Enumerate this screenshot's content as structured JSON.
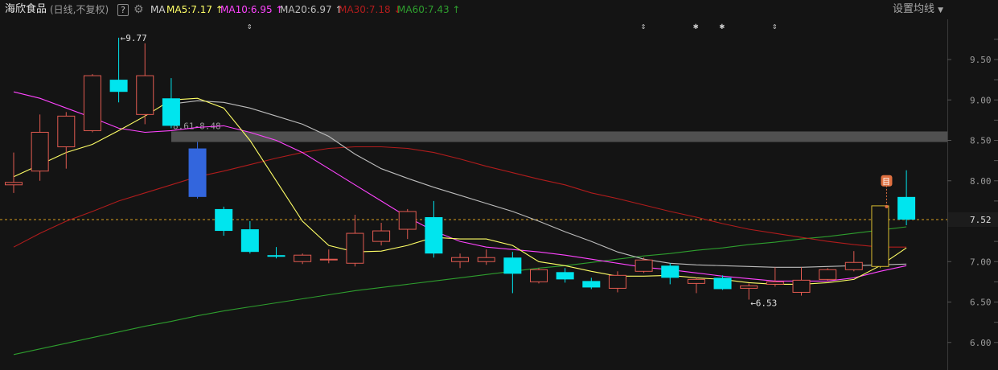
{
  "header": {
    "stock_name": "海欣食品",
    "mode": "(日线,不复权)",
    "help": "?",
    "settings_label": "设置均线",
    "indicator_label": "MA",
    "ma": [
      {
        "label": "MA5:7.17",
        "arrow": "↑",
        "color": "#ffff66"
      },
      {
        "label": "MA10:6.95",
        "arrow": "↑",
        "color": "#ff44ff"
      },
      {
        "label": "MA20:6.97",
        "arrow": "↑",
        "color": "#bdbdbd"
      },
      {
        "label": "MA30:7.18",
        "arrow": "↓",
        "color": "#b01c1c"
      },
      {
        "label": "MA60:7.43",
        "arrow": "↑",
        "color": "#2e9e2e"
      }
    ]
  },
  "chart_data": {
    "type": "candlestick",
    "y_ticks": [
      "9.50",
      "9.00",
      "8.50",
      "8.00",
      "7.50",
      "7.00",
      "6.50",
      "6.00"
    ],
    "ylim": [
      5.95,
      9.95
    ],
    "current_price": "7.52",
    "high_label": "9.77",
    "low_label": "6.53",
    "gap_label": "8.61-8.48",
    "gap_range": [
      8.48,
      8.61
    ],
    "marker_badge": "目",
    "colors": {
      "up": "#e05a50",
      "down": "#00e5ee",
      "big_down": "#3366dd",
      "doji": "#d4b830",
      "ma5": "#ffff66",
      "ma10": "#ff44ff",
      "ma20": "#bdbdbd",
      "ma30": "#b01c1c",
      "ma60": "#2e9e2e"
    },
    "candles": [
      {
        "o": 7.95,
        "h": 8.35,
        "l": 7.85,
        "c": 7.98
      },
      {
        "o": 8.12,
        "h": 8.82,
        "l": 8.0,
        "c": 8.6
      },
      {
        "o": 8.42,
        "h": 8.85,
        "l": 8.15,
        "c": 8.8
      },
      {
        "o": 8.62,
        "h": 9.32,
        "l": 8.6,
        "c": 9.3
      },
      {
        "o": 9.25,
        "h": 9.77,
        "l": 8.97,
        "c": 9.1
      },
      {
        "o": 8.82,
        "h": 9.7,
        "l": 8.7,
        "c": 9.3
      },
      {
        "o": 9.02,
        "h": 9.27,
        "l": 8.65,
        "c": 8.68
      },
      {
        "o": 8.4,
        "h": 8.48,
        "l": 7.78,
        "c": 7.8,
        "big": true
      },
      {
        "o": 7.65,
        "h": 7.68,
        "l": 7.32,
        "c": 7.38
      },
      {
        "o": 7.4,
        "h": 7.5,
        "l": 7.1,
        "c": 7.12
      },
      {
        "o": 7.08,
        "h": 7.18,
        "l": 7.04,
        "c": 7.06
      },
      {
        "o": 7.0,
        "h": 7.1,
        "l": 6.97,
        "c": 7.08
      },
      {
        "o": 7.02,
        "h": 7.15,
        "l": 6.98,
        "c": 7.03
      },
      {
        "o": 6.98,
        "h": 7.58,
        "l": 6.94,
        "c": 7.35
      },
      {
        "o": 7.25,
        "h": 7.48,
        "l": 7.2,
        "c": 7.38
      },
      {
        "o": 7.4,
        "h": 7.65,
        "l": 7.28,
        "c": 7.62
      },
      {
        "o": 7.55,
        "h": 7.75,
        "l": 7.05,
        "c": 7.1
      },
      {
        "o": 7.0,
        "h": 7.1,
        "l": 6.92,
        "c": 7.05
      },
      {
        "o": 7.0,
        "h": 7.15,
        "l": 6.96,
        "c": 7.05
      },
      {
        "o": 7.05,
        "h": 7.12,
        "l": 6.61,
        "c": 6.85
      },
      {
        "o": 6.75,
        "h": 6.92,
        "l": 6.73,
        "c": 6.9
      },
      {
        "o": 6.87,
        "h": 6.92,
        "l": 6.74,
        "c": 6.78
      },
      {
        "o": 6.76,
        "h": 6.8,
        "l": 6.66,
        "c": 6.68
      },
      {
        "o": 6.67,
        "h": 6.88,
        "l": 6.62,
        "c": 6.83
      },
      {
        "o": 6.88,
        "h": 7.05,
        "l": 6.86,
        "c": 7.02
      },
      {
        "o": 6.95,
        "h": 6.98,
        "l": 6.72,
        "c": 6.8
      },
      {
        "o": 6.73,
        "h": 6.8,
        "l": 6.61,
        "c": 6.78
      },
      {
        "o": 6.8,
        "h": 6.83,
        "l": 6.65,
        "c": 6.66
      },
      {
        "o": 6.67,
        "h": 6.73,
        "l": 6.53,
        "c": 6.7
      },
      {
        "o": 6.72,
        "h": 6.93,
        "l": 6.69,
        "c": 6.75
      },
      {
        "o": 6.62,
        "h": 6.93,
        "l": 6.58,
        "c": 6.77
      },
      {
        "o": 6.78,
        "h": 6.92,
        "l": 6.76,
        "c": 6.9
      },
      {
        "o": 6.9,
        "h": 7.13,
        "l": 6.88,
        "c": 6.99
      },
      {
        "o": 6.94,
        "h": 7.69,
        "l": 6.92,
        "c": 7.69,
        "doji": true
      },
      {
        "o": 7.8,
        "h": 8.13,
        "l": 7.45,
        "c": 7.52
      }
    ],
    "ma_series": {
      "ma5": [
        8.05,
        8.2,
        8.35,
        8.45,
        8.62,
        8.8,
        9.0,
        9.02,
        8.9,
        8.5,
        8.0,
        7.5,
        7.2,
        7.12,
        7.13,
        7.2,
        7.3,
        7.28,
        7.28,
        7.2,
        7.0,
        6.95,
        6.88,
        6.82,
        6.82,
        6.83,
        6.8,
        6.78,
        6.74,
        6.72,
        6.72,
        6.74,
        6.78,
        6.95,
        7.17
      ],
      "ma10": [
        9.1,
        9.02,
        8.9,
        8.78,
        8.65,
        8.6,
        8.62,
        8.66,
        8.68,
        8.6,
        8.5,
        8.35,
        8.15,
        7.95,
        7.75,
        7.55,
        7.38,
        7.25,
        7.18,
        7.15,
        7.12,
        7.08,
        7.03,
        6.98,
        6.93,
        6.9,
        6.86,
        6.82,
        6.79,
        6.76,
        6.76,
        6.76,
        6.8,
        6.88,
        6.95
      ],
      "ma20": [
        null,
        null,
        null,
        null,
        null,
        null,
        8.95,
        8.99,
        8.97,
        8.9,
        8.8,
        8.7,
        8.55,
        8.33,
        8.15,
        8.03,
        7.92,
        7.82,
        7.72,
        7.62,
        7.5,
        7.37,
        7.25,
        7.12,
        7.03,
        6.98,
        6.96,
        6.95,
        6.94,
        6.93,
        6.93,
        6.94,
        6.95,
        6.96,
        6.97
      ],
      "ma30": [
        7.18,
        7.35,
        7.5,
        7.62,
        7.75,
        7.85,
        7.95,
        8.05,
        8.12,
        8.2,
        8.28,
        8.35,
        8.4,
        8.42,
        8.42,
        8.4,
        8.35,
        8.27,
        8.18,
        8.1,
        8.02,
        7.95,
        7.85,
        7.78,
        7.7,
        7.62,
        7.55,
        7.47,
        7.4,
        7.35,
        7.3,
        7.25,
        7.21,
        7.18,
        7.18
      ],
      "ma60": [
        5.85,
        5.92,
        5.99,
        6.06,
        6.13,
        6.2,
        6.26,
        6.33,
        6.39,
        6.44,
        6.49,
        6.54,
        6.59,
        6.64,
        6.68,
        6.72,
        6.76,
        6.8,
        6.84,
        6.88,
        6.92,
        6.95,
        6.99,
        7.03,
        7.07,
        7.1,
        7.14,
        7.17,
        7.21,
        7.24,
        7.28,
        7.31,
        7.35,
        7.39,
        7.43
      ]
    },
    "event_markers": [
      {
        "index": 9,
        "symbol": "⇕"
      },
      {
        "index": 24,
        "symbol": "⇕"
      },
      {
        "index": 26,
        "symbol": "✱"
      },
      {
        "index": 27,
        "symbol": "✱"
      },
      {
        "index": 29,
        "symbol": "⇕"
      }
    ]
  }
}
